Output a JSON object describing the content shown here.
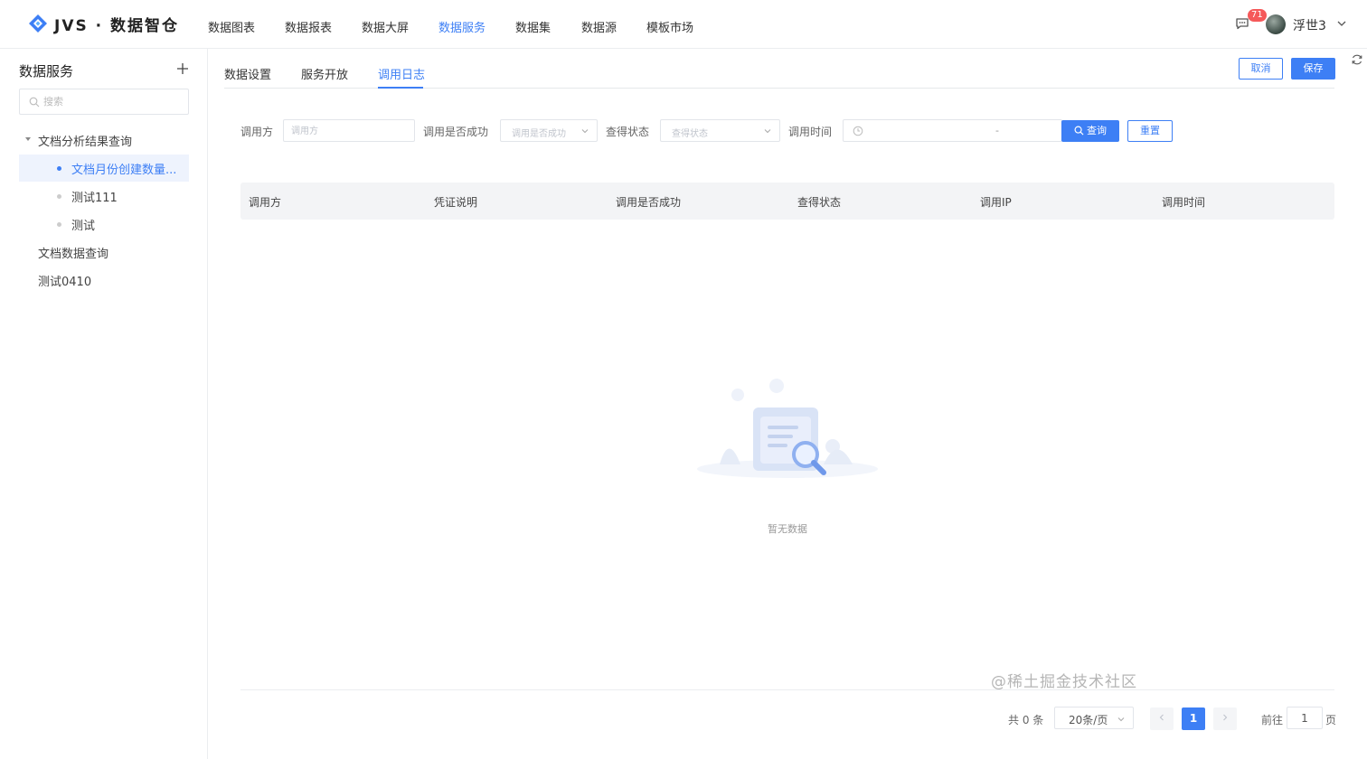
{
  "brand": {
    "name": "JVS · 数据智仓"
  },
  "nav": {
    "items": [
      {
        "label": "数据图表",
        "active": false
      },
      {
        "label": "数据报表",
        "active": false
      },
      {
        "label": "数据大屏",
        "active": false
      },
      {
        "label": "数据服务",
        "active": true
      },
      {
        "label": "数据集",
        "active": false
      },
      {
        "label": "数据源",
        "active": false
      },
      {
        "label": "模板市场",
        "active": false
      }
    ]
  },
  "user": {
    "message_count": "71",
    "name": "浮世3"
  },
  "sidebar": {
    "title": "数据服务",
    "search_placeholder": "搜索",
    "tree": [
      {
        "label": "文档分析结果查询",
        "expanded": true
      },
      {
        "label": "文档月份创建数量...",
        "active": true
      },
      {
        "label": "测试111"
      },
      {
        "label": "测试"
      },
      {
        "label": "文档数据查询"
      },
      {
        "label": "测试0410"
      }
    ]
  },
  "tabs": [
    {
      "label": "数据设置"
    },
    {
      "label": "服务开放"
    },
    {
      "label": "调用日志",
      "active": true
    }
  ],
  "actions": {
    "cancel": "取消",
    "save": "保存"
  },
  "filters": {
    "caller_label": "调用方",
    "caller_placeholder": "调用方",
    "success_label": "调用是否成功",
    "success_placeholder": "调用是否成功",
    "status_label": "查得状态",
    "status_placeholder": "查得状态",
    "time_label": "调用时间",
    "time_separator": "-",
    "query_button": "查询",
    "reset_button": "重置"
  },
  "table": {
    "columns": [
      "调用方",
      "凭证说明",
      "调用是否成功",
      "查得状态",
      "调用IP",
      "调用时间"
    ],
    "rows": [],
    "empty_text": "暂无数据"
  },
  "pagination": {
    "total_text": "共 0 条",
    "page_size": "20条/页",
    "current_page": "1",
    "goto_label": "前往",
    "goto_value": "1",
    "goto_unit": "页"
  },
  "watermark": "@稀土掘金技术社区",
  "colors": {
    "accent": "#3d7ff5",
    "badge": "#f5595a"
  }
}
